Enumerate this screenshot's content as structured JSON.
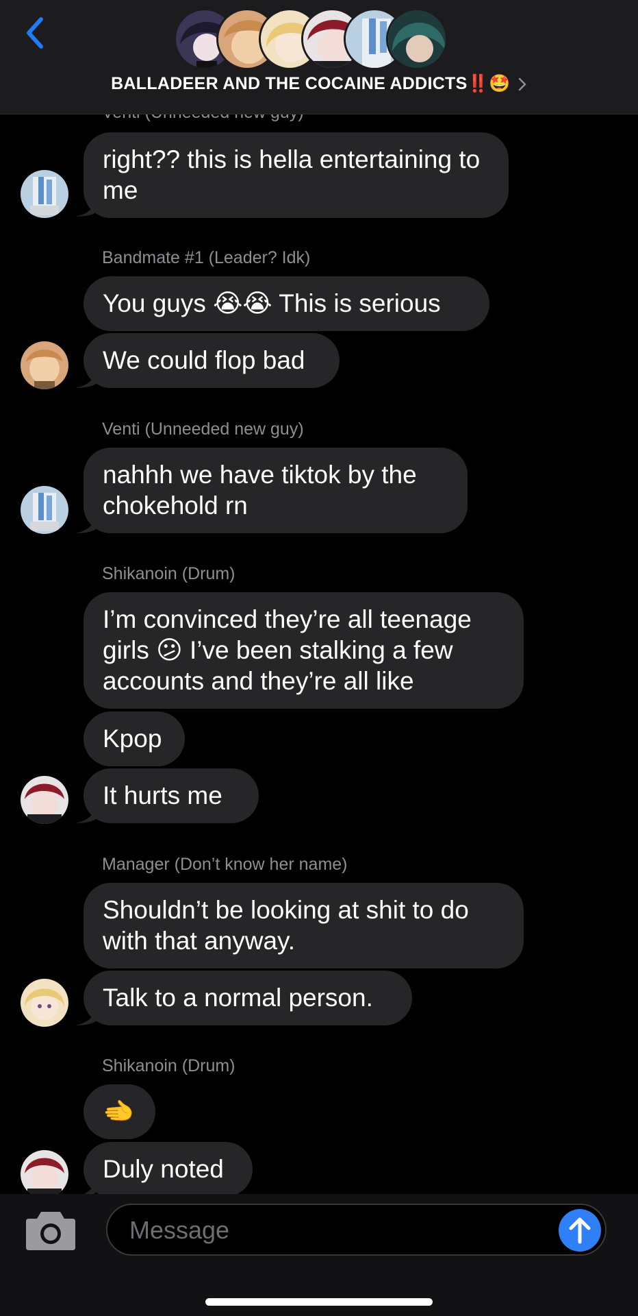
{
  "header": {
    "title": "BALLADEER AND THE COCAINE ADDICTS‼️🤩",
    "back_icon": "chevron-left-icon",
    "title_chevron_icon": "chevron-right-icon",
    "accent_color": "#1f7cf6"
  },
  "thread": {
    "partial_sender": "Venti (Unneeded new guy)",
    "groups": [
      {
        "sender": "Venti (Unneeded new guy)",
        "avatar": "avatar-venti",
        "messages": [
          "right?? this is hella entertaining to me"
        ]
      },
      {
        "sender": "Bandmate #1 (Leader? Idk)",
        "avatar": "avatar-bandmate",
        "messages": [
          "You guys 😭😭 This is serious",
          "We could flop bad"
        ]
      },
      {
        "sender": "Venti (Unneeded new guy)",
        "avatar": "avatar-venti",
        "messages": [
          "nahhh we have tiktok by the chokehold rn"
        ]
      },
      {
        "sender": "Shikanoin (Drum)",
        "avatar": "avatar-shikanoin",
        "messages": [
          "I’m convinced they’re all teenage girls 😕 I’ve been stalking a few accounts and they’re all like",
          "Kpop",
          "It hurts me"
        ]
      },
      {
        "sender": "Manager (Don’t know her name)",
        "avatar": "avatar-manager",
        "messages": [
          "Shouldn’t be looking at shit to do with that anyway.",
          "Talk to a normal person."
        ]
      },
      {
        "sender": "Shikanoin (Drum)",
        "avatar": "avatar-shikanoin",
        "messages": [
          "🫲",
          "Duly noted"
        ]
      }
    ]
  },
  "composer": {
    "placeholder": "Message",
    "camera_icon": "camera-icon",
    "send_icon": "arrow-up-icon",
    "send_color": "#2f80f7"
  }
}
